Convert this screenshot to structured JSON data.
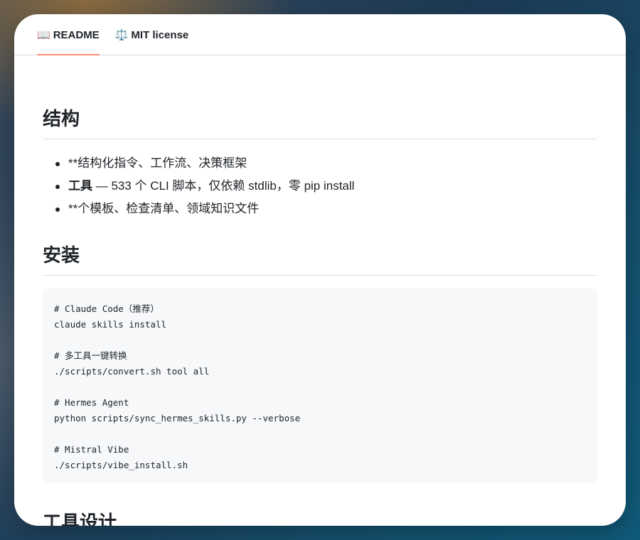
{
  "tabs": [
    {
      "icon": "📖",
      "label": "README",
      "active": true
    },
    {
      "icon": "⚖️",
      "label": "MIT license",
      "active": false
    }
  ],
  "sections": {
    "structure": {
      "heading": "结构",
      "items": [
        {
          "bold": "",
          "text": "**结构化指令、工作流、决策框架"
        },
        {
          "bold": "工具",
          "text": " — 533 个 CLI 脚本，仅依赖 stdlib，零 pip install"
        },
        {
          "bold": "",
          "text": "**个模板、检查清单、领域知识文件"
        }
      ]
    },
    "install": {
      "heading": "安装",
      "code_lines": [
        "# Claude Code（推荐）",
        "claude skills install",
        "",
        "# 多工具一键转换",
        "./scripts/convert.sh tool all",
        "",
        "# Hermes Agent",
        "python scripts/sync_hermes_skills.py --verbose",
        "",
        "# Mistral Vibe",
        "./scripts/vibe_install.sh"
      ]
    },
    "next": {
      "heading": "工具设计"
    }
  },
  "colors": {
    "tab_underline": "#fd8c73",
    "code_bg": "#f6f8fa",
    "text": "#1f2328",
    "divider": "#d8dee4"
  }
}
